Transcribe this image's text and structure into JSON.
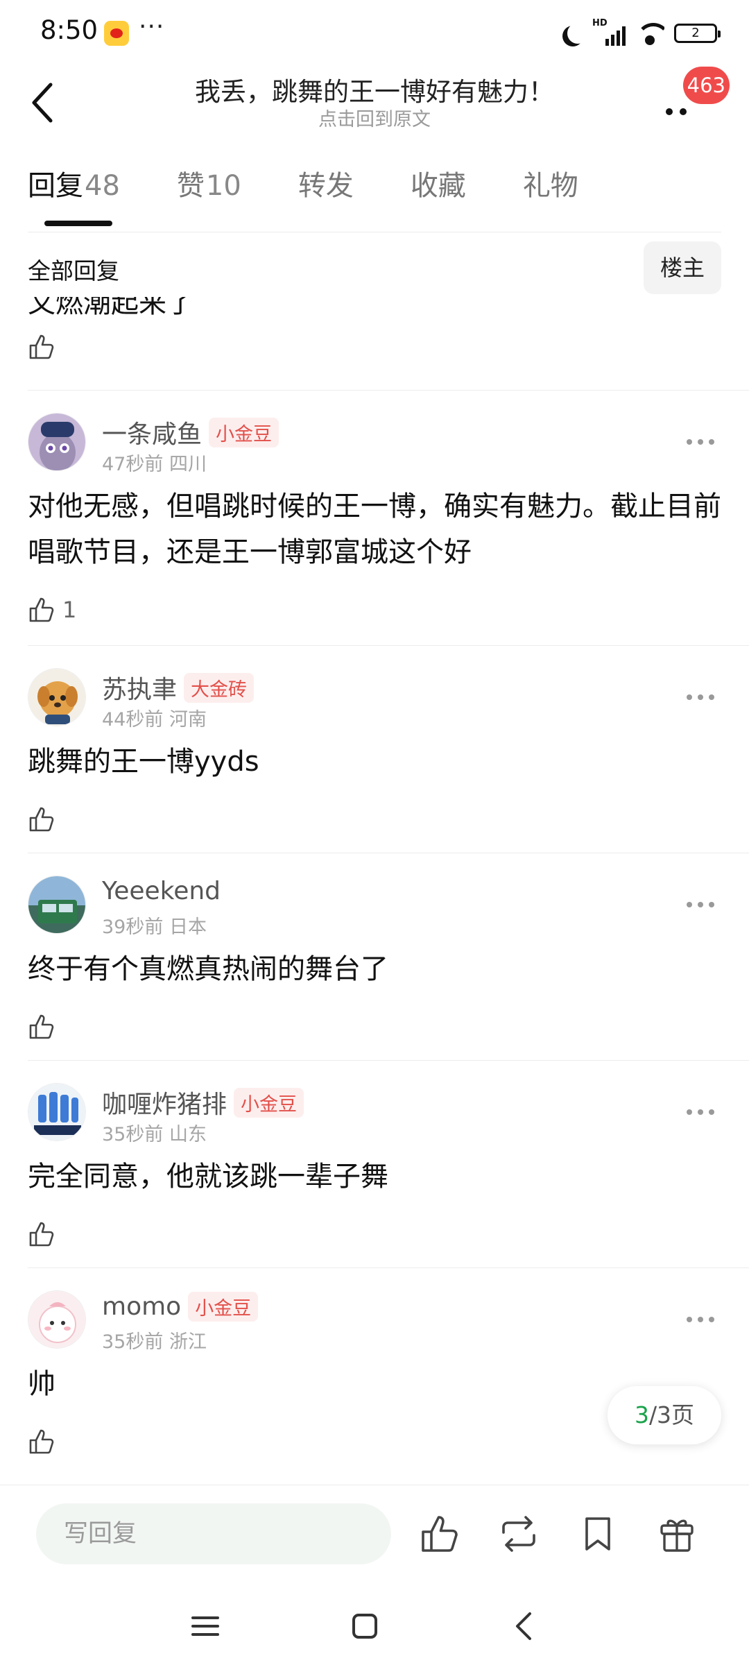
{
  "status_bar": {
    "time": "8:50",
    "dots": "···",
    "battery": "2"
  },
  "header": {
    "title": "我丢，跳舞的王一博好有魅力！",
    "subtitle": "点击回到原文",
    "badge": "463"
  },
  "tabs": [
    {
      "label": "回复",
      "count": "48",
      "active": true
    },
    {
      "label": "赞",
      "count": "10",
      "active": false
    },
    {
      "label": "转发",
      "count": "",
      "active": false
    },
    {
      "label": "收藏",
      "count": "",
      "active": false
    },
    {
      "label": "礼物",
      "count": "",
      "active": false
    }
  ],
  "section": {
    "title": "全部回复",
    "owner_button": "楼主"
  },
  "partial_comment": {
    "text": "又燃潮起来了"
  },
  "comments": [
    {
      "username": "一条咸鱼",
      "tag": "小金豆",
      "time": "47秒前",
      "location": "四川",
      "text": "对他无感，但唱跳时候的王一博，确实有魅力。截止目前唱歌节目，还是王一博郭富城这个好",
      "likes": "1"
    },
    {
      "username": "苏执聿",
      "tag": "大金砖",
      "time": "44秒前",
      "location": "河南",
      "text": "跳舞的王一博yyds",
      "likes": ""
    },
    {
      "username": "Yeeekend",
      "tag": "",
      "time": "39秒前",
      "location": "日本",
      "text": "终于有个真燃真热闹的舞台了",
      "likes": ""
    },
    {
      "username": "咖喱炸猪排",
      "tag": "小金豆",
      "time": "35秒前",
      "location": "山东",
      "text": "完全同意，他就该跳一辈子舞",
      "likes": ""
    },
    {
      "username": "momo",
      "tag": "小金豆",
      "time": "35秒前",
      "location": "浙江",
      "text": "帅",
      "likes": ""
    }
  ],
  "page_indicator": {
    "current": "3",
    "rest": "/3页"
  },
  "bottom_bar": {
    "reply_placeholder": "写回复"
  },
  "colors": {
    "accent_green": "#1aa34a",
    "badge_red": "#f04b4b",
    "tag_red": "#e2504a"
  },
  "icons": [
    "back-icon",
    "more-icon",
    "like-icon",
    "repost-icon",
    "bookmark-icon",
    "gift-icon",
    "menu-icon",
    "home-icon",
    "nav-back-icon"
  ]
}
